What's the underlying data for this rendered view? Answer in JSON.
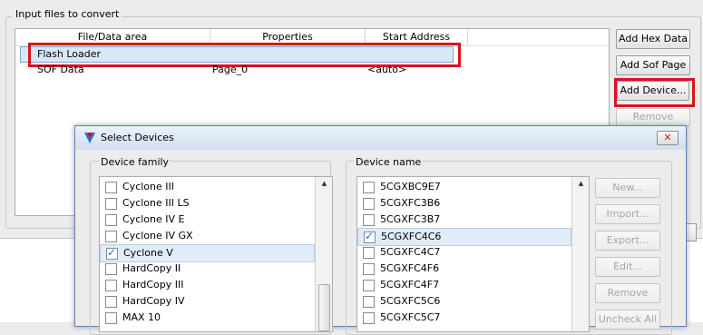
{
  "main": {
    "group_title": "Input files to convert",
    "columns": [
      "File/Data area",
      "Properties",
      "Start Address"
    ],
    "rows": [
      {
        "area": "Flash Loader",
        "properties": "",
        "start": ""
      },
      {
        "area": "SOF Data",
        "properties": "Page_0",
        "start": "<auto>"
      }
    ],
    "buttons": {
      "add_hex": "Add Hex Data",
      "add_sof": "Add Sof Page",
      "add_device": "Add Device...",
      "remove": "Remove"
    },
    "highlight_color": "#d9131f"
  },
  "dialog": {
    "title": "Select Devices",
    "family_label": "Device family",
    "name_label": "Device name",
    "families": [
      {
        "label": "Cyclone III",
        "checked": false
      },
      {
        "label": "Cyclone III LS",
        "checked": false
      },
      {
        "label": "Cyclone IV E",
        "checked": false
      },
      {
        "label": "Cyclone IV GX",
        "checked": false
      },
      {
        "label": "Cyclone V",
        "checked": true
      },
      {
        "label": "HardCopy II",
        "checked": false
      },
      {
        "label": "HardCopy III",
        "checked": false
      },
      {
        "label": "HardCopy IV",
        "checked": false
      },
      {
        "label": "MAX 10",
        "checked": false
      }
    ],
    "devices": [
      {
        "label": "5CGXBC9E7",
        "checked": false
      },
      {
        "label": "5CGXFC3B6",
        "checked": false
      },
      {
        "label": "5CGXFC3B7",
        "checked": false
      },
      {
        "label": "5CGXFC4C6",
        "checked": true
      },
      {
        "label": "5CGXFC4C7",
        "checked": false
      },
      {
        "label": "5CGXFC4F6",
        "checked": false
      },
      {
        "label": "5CGXFC4F7",
        "checked": false
      },
      {
        "label": "5CGXFC5C6",
        "checked": false
      },
      {
        "label": "5CGXFC5C7",
        "checked": false
      }
    ],
    "buttons": {
      "new": "New...",
      "import": "Import...",
      "export": "Export...",
      "edit": "Edit...",
      "remove": "Remove",
      "uncheck_all": "Uncheck All"
    }
  }
}
